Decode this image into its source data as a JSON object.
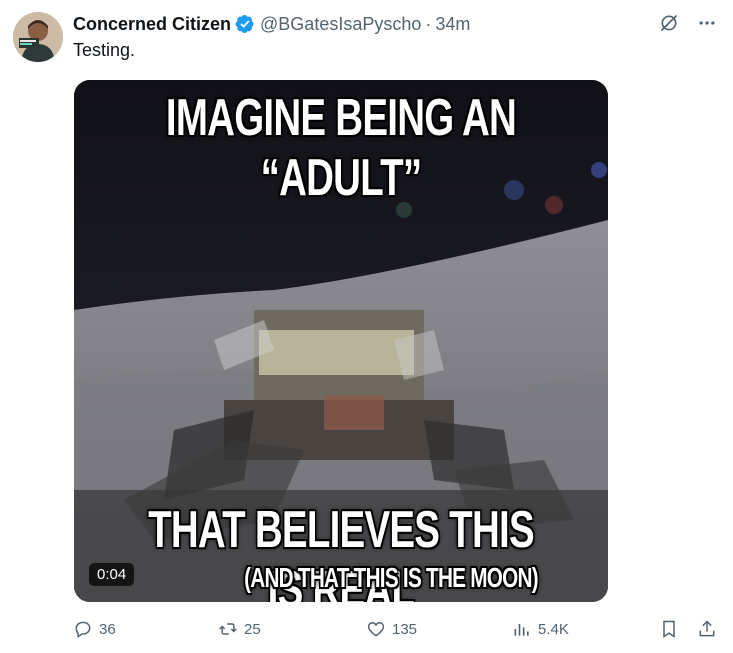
{
  "tweet": {
    "author_name": "Concerned Citizen",
    "handle": "@BGatesIsaPyscho",
    "separator": "·",
    "time": "34m",
    "text": "Testing."
  },
  "media": {
    "caption_top": "IMAGINE BEING AN “ADULT”",
    "caption_bottom": "THAT BELIEVES THIS IS REAL",
    "caption_sub": "(AND THAT THIS IS THE MOON)",
    "duration": "0:04"
  },
  "actions": {
    "replies": "36",
    "retweets": "25",
    "likes": "135",
    "views": "5.4K"
  },
  "icons": [
    "verified-badge-icon",
    "grok-icon",
    "more-icon",
    "reply-icon",
    "retweet-icon",
    "like-icon",
    "views-icon",
    "bookmark-icon",
    "share-icon"
  ],
  "colors": {
    "verified": "#1d9bf0",
    "secondary_text": "#536471",
    "primary_text": "#0f1419"
  }
}
